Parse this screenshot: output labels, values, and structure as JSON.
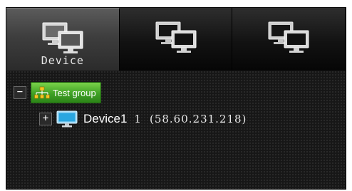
{
  "tabs": [
    {
      "label": "Device",
      "icon": "monitors-icon",
      "active": true
    },
    {
      "label": "",
      "icon": "monitors-icon",
      "active": false
    },
    {
      "label": "",
      "icon": "monitors-icon",
      "active": false
    }
  ],
  "tree": {
    "group": {
      "toggle": "−",
      "icon": "network-group-icon",
      "label": "Test group"
    },
    "device": {
      "toggle": "+",
      "icon": "monitor-icon",
      "name": "Device1",
      "channel": "1",
      "ip": "(58.60.231.218)"
    }
  },
  "colors": {
    "panel_bg": "#171717",
    "group_green": "#3fa125",
    "monitor_blue": "#2aa6e0"
  }
}
